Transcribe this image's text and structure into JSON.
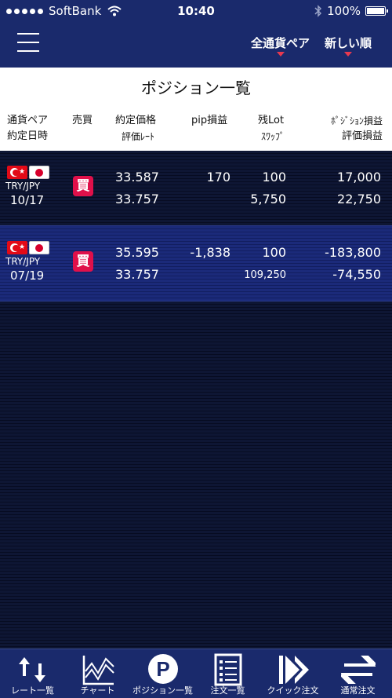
{
  "status_bar": {
    "carrier": "SoftBank",
    "time": "10:40",
    "battery": "100%"
  },
  "nav": {
    "currency_filter": "全通貨ペア",
    "sort_filter": "新しい順"
  },
  "page_title": "ポジション一覧",
  "columns": {
    "pair_line1": "通貨ペア",
    "pair_line2": "約定日時",
    "side": "売買",
    "price_line1": "約定価格",
    "price_line2": "評価ﾚｰﾄ",
    "pip": "pip損益",
    "lot_line1": "残Lot",
    "lot_line2": "ｽﾜｯﾌﾟ",
    "pl_line1": "ﾎﾟｼﾞｼｮﾝ損益",
    "pl_line2": "評価損益"
  },
  "positions": [
    {
      "pair": "TRY/JPY",
      "date": "10/17",
      "side": "買",
      "trade_price": "33.587",
      "eval_rate": "33.757",
      "pip_pl": "170",
      "lot": "100",
      "swap": "5,750",
      "position_pl": "17,000",
      "eval_pl": "22,750"
    },
    {
      "pair": "TRY/JPY",
      "date": "07/19",
      "side": "買",
      "trade_price": "35.595",
      "eval_rate": "33.757",
      "pip_pl": "-1,838",
      "lot": "100",
      "swap": "109,250",
      "position_pl": "-183,800",
      "eval_pl": "-74,550"
    }
  ],
  "tabs": [
    {
      "label": "レート一覧",
      "icon": "rate-list-icon"
    },
    {
      "label": "チャート",
      "icon": "chart-icon"
    },
    {
      "label": "ポジション一覧",
      "icon": "position-icon"
    },
    {
      "label": "注文一覧",
      "icon": "order-list-icon"
    },
    {
      "label": "クイック注文",
      "icon": "quick-order-icon"
    },
    {
      "label": "通常注文",
      "icon": "normal-order-icon"
    }
  ],
  "colors": {
    "navy": "#1a2a6c",
    "accent_red": "#e8394f",
    "buy_badge": "#e0104a"
  }
}
